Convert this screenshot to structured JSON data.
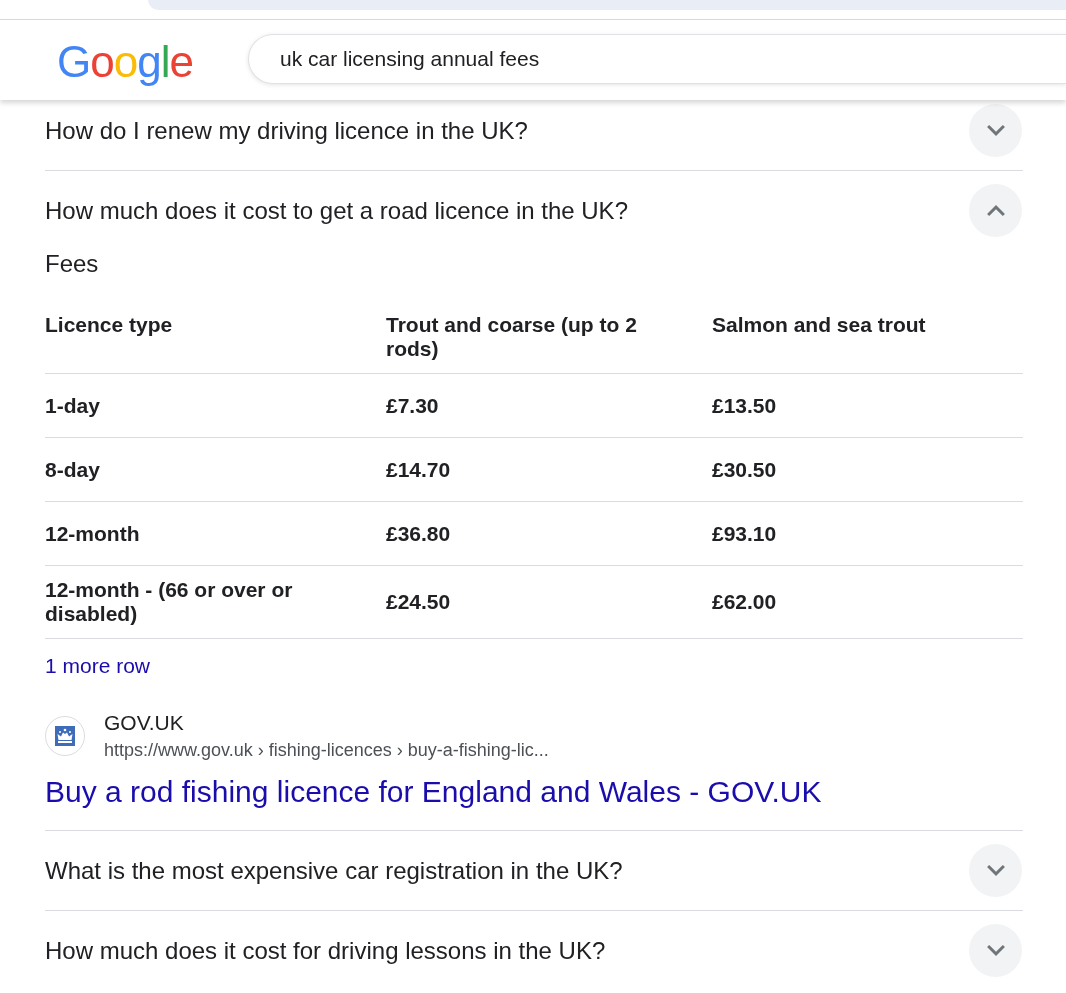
{
  "header": {
    "logo": "Google",
    "search": {
      "value": "uk car licensing annual fees"
    }
  },
  "questions": [
    {
      "text": "How do I renew my driving licence in the UK?",
      "expanded": false
    },
    {
      "text": "How much does it cost to get a road licence in the UK?",
      "expanded": true,
      "answer": {
        "heading": "Fees",
        "table": {
          "columns": [
            "Licence type",
            "Trout and coarse (up to 2 rods)",
            "Salmon and sea trout"
          ],
          "rows": [
            [
              "1-day",
              "£7.30",
              "£13.50"
            ],
            [
              "8-day",
              "£14.70",
              "£30.50"
            ],
            [
              "12-month",
              "£36.80",
              "£93.10"
            ],
            [
              "12-month - (66 or over or disabled)",
              "£24.50",
              "£62.00"
            ]
          ]
        },
        "more_rows": "1 more row",
        "source": {
          "site": "GOV.UK",
          "url": "https://www.gov.uk › fishing-licences › buy-a-fishing-lic...",
          "title": "Buy a rod fishing licence for England and Wales - GOV.UK"
        }
      }
    },
    {
      "text": "What is the most expensive car registration in the UK?",
      "expanded": false
    },
    {
      "text": "How much does it cost for driving lessons in the UK?",
      "expanded": false
    }
  ]
}
